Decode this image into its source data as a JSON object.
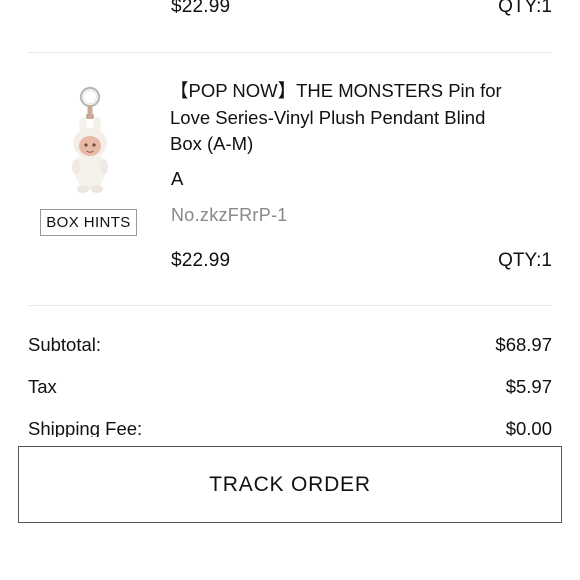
{
  "previous_item": {
    "price": "$22.99",
    "qty": "QTY:1"
  },
  "item": {
    "title_lines": [
      "【POP NOW】THE MONSTERS Pin for",
      "Love Series-Vinyl Plush Pendant Blind",
      "Box (A-M)"
    ],
    "variant": "A",
    "sku": "No.zkzFRrP-1",
    "price": "$22.99",
    "qty": "QTY:1",
    "hints_label": "BOX HINTS",
    "image_icon": "plush-keychain-image"
  },
  "summary": {
    "subtotal_label": "Subtotal:",
    "subtotal_value": "$68.97",
    "tax_label": "Tax",
    "tax_value": "$5.97",
    "shipping_label": "Shipping Fee:",
    "shipping_value": "$0.00"
  },
  "actions": {
    "track_order_label": "TRACK ORDER"
  }
}
